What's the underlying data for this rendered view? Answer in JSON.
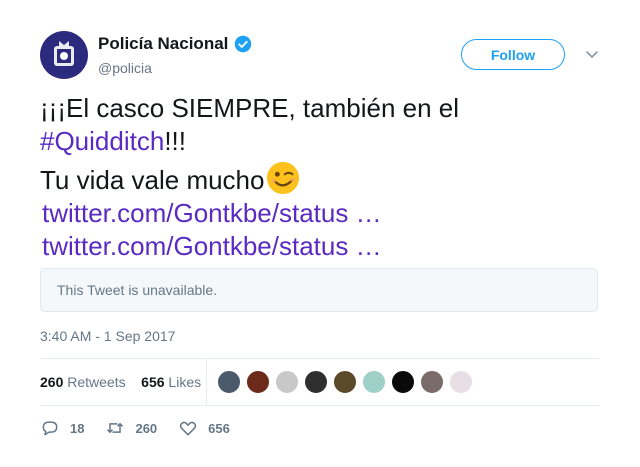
{
  "account": {
    "display_name": "Policía Nacional",
    "handle": "@policia",
    "verified_icon": "verified-badge-icon",
    "follow_label": "Follow"
  },
  "tweet": {
    "line1": "¡¡¡El casco SIEMPRE, también en el",
    "hashtag": "#Quidditch",
    "hashtag_suffix": "!!!",
    "line3": "Tu vida vale mucho",
    "emoji": "winking-face-emoji",
    "links": [
      "twitter.com/Gontkbe/status …",
      "twitter.com/Gontkbe/status …"
    ],
    "quote_unavailable": "This Tweet is unavailable.",
    "timestamp": "3:40 AM - 1 Sep 2017"
  },
  "stats": {
    "retweets_count": "260",
    "retweets_label": "Retweets",
    "likes_count": "656",
    "likes_label": "Likes"
  },
  "actions": {
    "reply_count": "18",
    "retweet_count": "260",
    "like_count": "656"
  },
  "colors": {
    "accent": "#1da1f2",
    "link": "#5a2ac4",
    "muted": "#657786"
  },
  "likers": [
    {
      "name": "liker-avatar-1",
      "color": "#4a5a6a"
    },
    {
      "name": "liker-avatar-2",
      "color": "#6b2a1a"
    },
    {
      "name": "liker-avatar-3",
      "color": "#c8c8c8"
    },
    {
      "name": "liker-avatar-4",
      "color": "#2f2f2f"
    },
    {
      "name": "liker-avatar-5",
      "color": "#5a4a2a"
    },
    {
      "name": "liker-avatar-6",
      "color": "#9fd0c8"
    },
    {
      "name": "liker-avatar-7",
      "color": "#0a0a0a"
    },
    {
      "name": "liker-avatar-8",
      "color": "#7a6a6a"
    },
    {
      "name": "liker-avatar-9",
      "color": "#e8dfe6"
    }
  ]
}
